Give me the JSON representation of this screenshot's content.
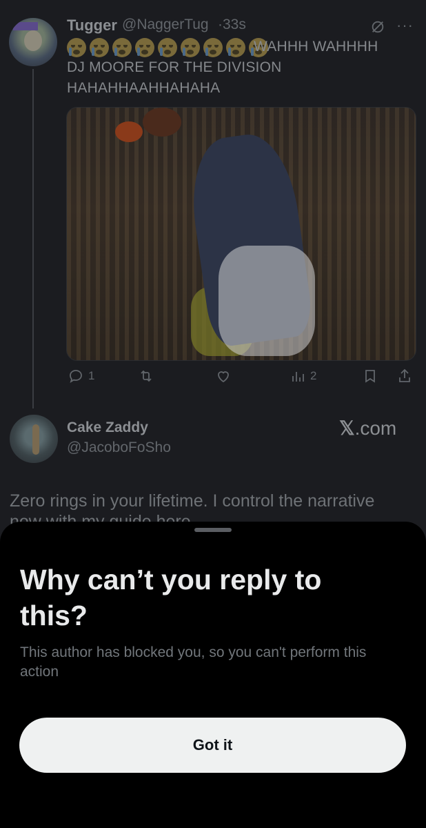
{
  "colors": {
    "background": "#1b1c20",
    "sheet": "#000000",
    "button": "#eff1f1",
    "title": "#e9eaeb",
    "muted": "#71767b"
  },
  "tweet1": {
    "name": "Tugger",
    "handle": "@NaggerTug",
    "time": "·33s",
    "emoji_count": 9,
    "text_line1": "WAHHH WAHHHH",
    "text_line2": "DJ MOORE FOR THE DIVISION",
    "text_line3": "HAHAHHAAHHAHAHA",
    "reply_count": "1",
    "views_count": "2",
    "icons": [
      "grok-icon",
      "more-icon",
      "reply-icon",
      "retweet-icon",
      "like-icon",
      "views-icon",
      "bookmark-icon",
      "share-icon"
    ]
  },
  "tweet2": {
    "name": "Cake Zaddy",
    "handle": "@JacoboFoSho",
    "brand_x": "𝕏",
    "brand_com": ".com",
    "text_line1": "Zero rings in your lifetime. I control the narrative",
    "text_line2": "now with my guide here"
  },
  "sheet": {
    "title": "Why can’t you reply to this?",
    "body": "This author has blocked you, so you can't perform this action",
    "button_label": "Got it"
  }
}
